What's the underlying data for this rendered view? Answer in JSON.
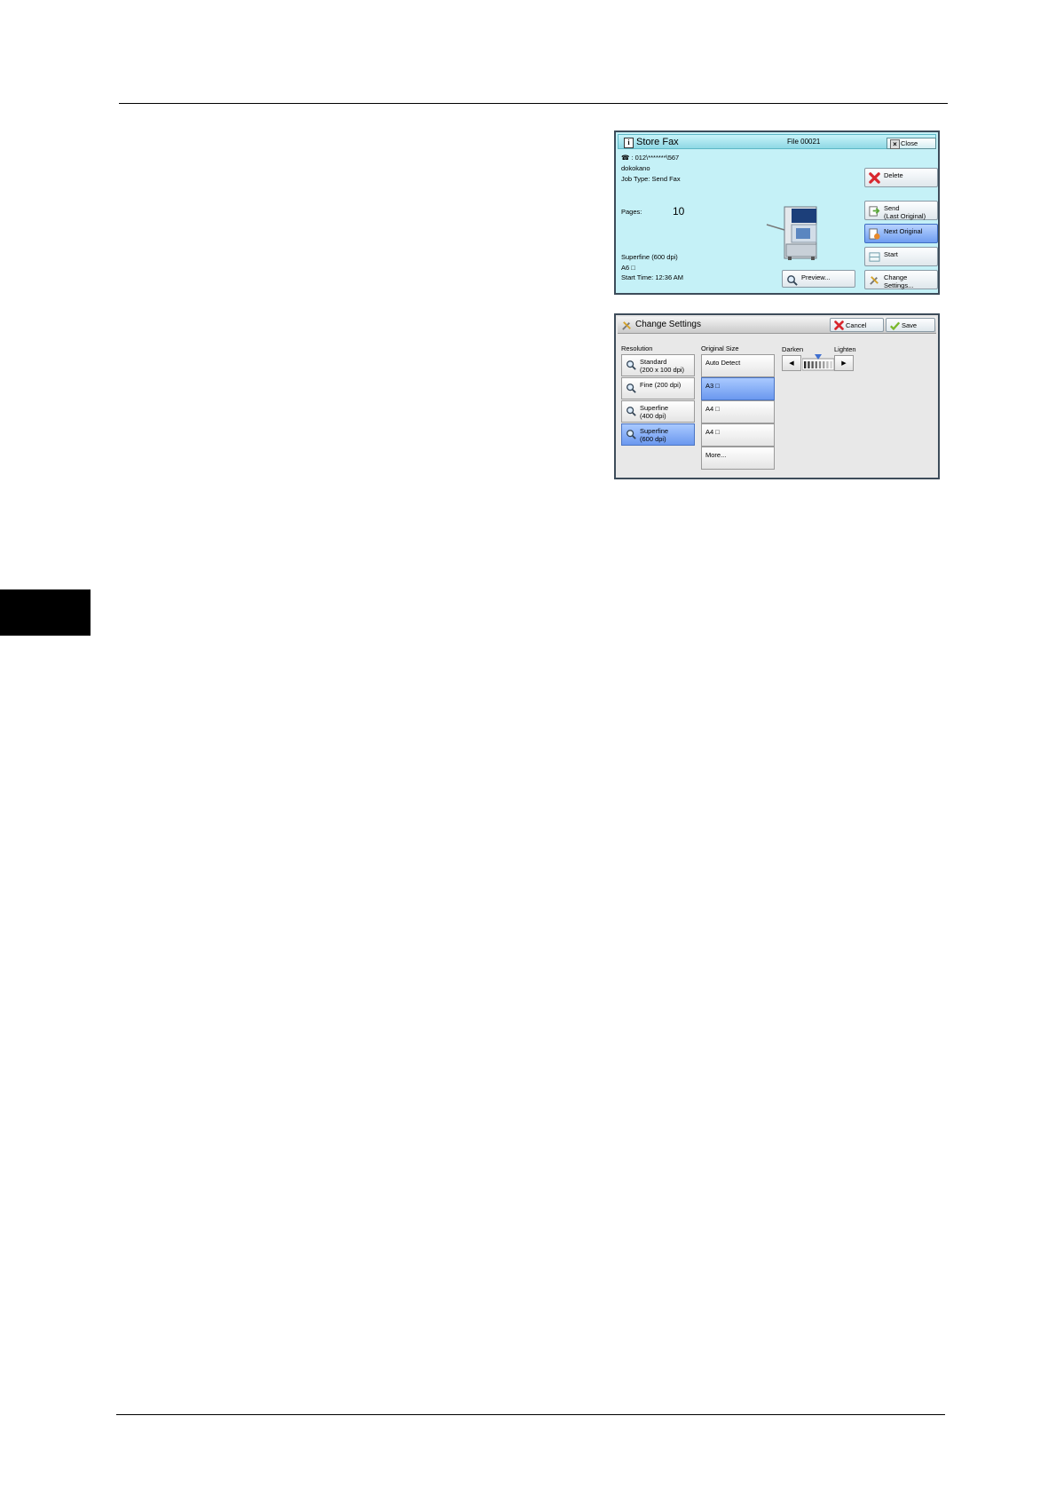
{
  "store_fax": {
    "title": "Store Fax",
    "file": "File 00021",
    "close_label": "Close",
    "fax_number": "☎ : 012\\*******\\567",
    "recipient": "dokokano",
    "job_type": "Job Type: Send Fax",
    "pages_label": "Pages:",
    "pages_value": "10",
    "resolution": "Superfine (600 dpi)",
    "paper": "A6 □",
    "start_time": "Start Time: 12:36 AM",
    "delete_label": "Delete",
    "send_label": "Send\n(Last Original)",
    "next_label": "Next Original",
    "start_label": "Start",
    "preview_label": "Preview...",
    "change_label": "Change\nSettings..."
  },
  "change_settings": {
    "title": "Change Settings",
    "cancel_label": "Cancel",
    "save_label": "Save",
    "resolution_header": "Resolution",
    "size_header": "Original Size",
    "darken_label": "Darken",
    "lighten_label": "Lighten",
    "resolution_options": [
      {
        "label": "Standard\n(200 x 100 dpi)",
        "selected": false
      },
      {
        "label": "Fine (200 dpi)",
        "selected": false
      },
      {
        "label": "Superfine\n(400 dpi)",
        "selected": false
      },
      {
        "label": "Superfine\n(600 dpi)",
        "selected": true
      }
    ],
    "size_options": [
      {
        "label": "Auto Detect",
        "selected": false
      },
      {
        "label": "A3 □",
        "selected": true
      },
      {
        "label": "A4 □",
        "selected": false
      },
      {
        "label": "A4 □",
        "selected": false
      },
      {
        "label": "More...",
        "selected": false
      }
    ],
    "density_level": 0.5
  },
  "colors": {
    "fax_panel_bg": "#c5f1f7",
    "selected_blue": "#6f9df0",
    "delete_red": "#d8272e"
  }
}
